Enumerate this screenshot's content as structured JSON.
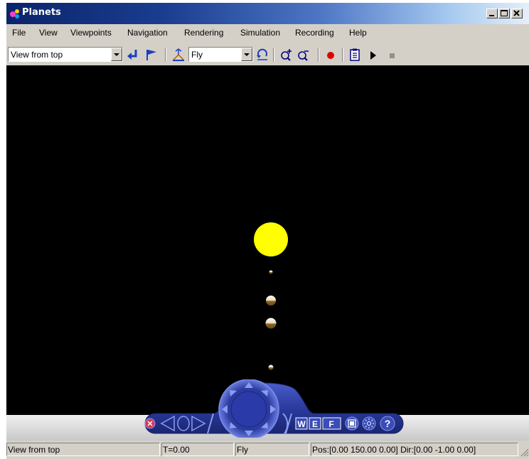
{
  "window": {
    "title": "Planets"
  },
  "menu": [
    "File",
    "View",
    "Viewpoints",
    "Navigation",
    "Rendering",
    "Simulation",
    "Recording",
    "Help"
  ],
  "toolbar": {
    "viewpoint_value": "View from top",
    "nav_mode_value": "Fly"
  },
  "icons": {
    "back": "back-arrow-icon",
    "flag": "flag-icon",
    "straighten": "straighten-icon",
    "undo": "undo-move-icon",
    "zoom_in": "zoom-in-icon",
    "zoom_out": "zoom-out-icon",
    "record": "record-icon",
    "clipboard": "clipboard-icon",
    "play": "play-icon",
    "stop": "stop-icon"
  },
  "nav_panel": {
    "w": "W",
    "e": "E",
    "f": "F",
    "help": "?"
  },
  "status": {
    "viewpoint": "View from top",
    "time": "T=0.00",
    "mode": "Fly",
    "position": "Pos:[0.00 150.00 0.00] Dir:[0.00 -1.00 0.00]"
  },
  "colors": {
    "sun": "#ffff00",
    "sky": "#000000",
    "nav_blue": "#2a3a9e"
  }
}
